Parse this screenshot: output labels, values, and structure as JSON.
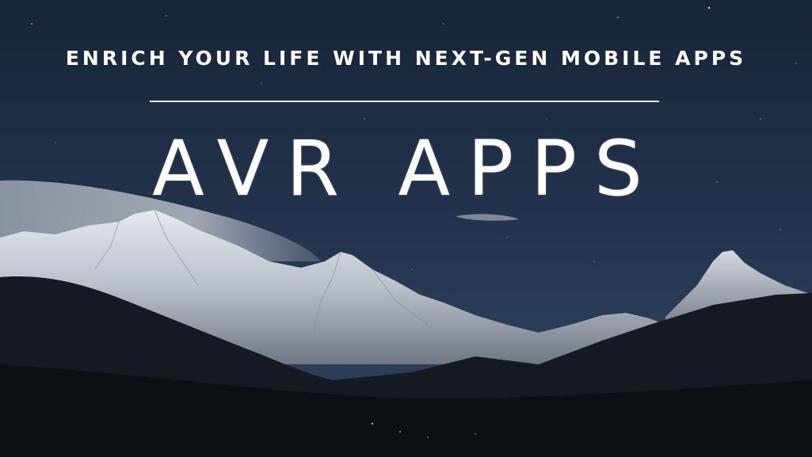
{
  "banner": {
    "tagline": "ENRICH YOUR LIFE WITH NEXT-GEN MOBILE APPS",
    "brand_name": "AVR APPS"
  },
  "colors": {
    "sky_top": "#1a2840",
    "sky_bottom": "#2a3b54",
    "text": "#ffffff",
    "foreground": "#0e1218"
  }
}
